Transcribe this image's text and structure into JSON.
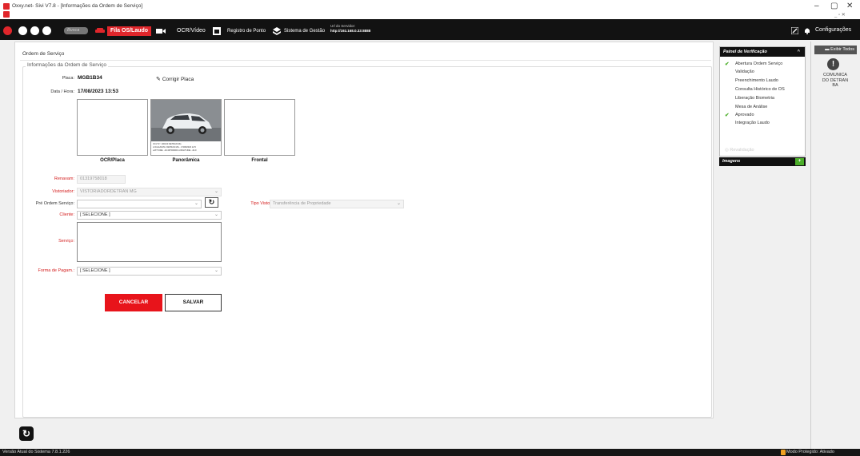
{
  "window": {
    "title": "Oxxy.net- Sivi V7.8 - [Informações da Ordem de Serviço]",
    "controls": [
      "–",
      "▢",
      "✕"
    ],
    "inner_controls": "_ ▫ ✕"
  },
  "toolbar": {
    "search_placeholder": "Busca",
    "tabs": [
      "Fila OS/Laudo",
      "OCR/Vídeo",
      "Registro de Ponto",
      "Sistema de Gestão"
    ],
    "server_label": "Url do Servidor:",
    "server_url": "http://192.168.0.33:8888",
    "settings_label": "Configurações"
  },
  "form": {
    "section_title": "Ordem de Serviço",
    "group_title": "Informações da Ordem de Serviço",
    "placa_label": "Placa:",
    "placa_value": "MGB1B34",
    "corrigir_label": "Corrigir Placa",
    "data_hora_label": "Data / Hora:",
    "data_hora_value": "17/08/2023  13:53",
    "photo_captions": [
      "OCR/Placa",
      "Panorâmica",
      "Frontal"
    ],
    "photo_overlay": [
      "OCV Nº: 100133 DETRAN MG",
      "LOCAL/DATA: DETRAN MG - 17/08/2023 12:5",
      "LATITUDE: -19.467000000 LONGITUDE: -44.9"
    ],
    "renavam_label": "Renavam:",
    "renavam_value": "01319758018",
    "vistoriador_label": "Vistoriador:",
    "vistoriador_value": "VISTORIADORDETRAN MG",
    "pre_ordem_label": "Pré Ordem Serviço:",
    "pre_ordem_value": "",
    "tipo_vistoria_label": "Tipo Vistoria:",
    "tipo_vistoria_value": "Transferência de Propriedade",
    "cliente_label": "Cliente:",
    "cliente_value": "[ SELECIONE ]",
    "servico_label": "Serviço:",
    "forma_pagamento_label": "Forma de Pagam.:",
    "forma_pagamento_value": "[ SELECIONE ]",
    "cancel_label": "CANCELAR",
    "save_label": "SALVAR"
  },
  "panel": {
    "title": "Painel de Verificação",
    "items": [
      {
        "label": "Abertura Ordem Serviço",
        "checked": true
      },
      {
        "label": "Validação",
        "checked": false
      },
      {
        "label": "Preenchimento Laudo",
        "checked": false
      },
      {
        "label": "Consulta Histórico de OS",
        "checked": false
      },
      {
        "label": "Liberação Biometria",
        "checked": false
      },
      {
        "label": "Mesa de Análise",
        "checked": false
      },
      {
        "label": "Aprovado",
        "checked": true
      },
      {
        "label": "Integração Laudo",
        "checked": false
      }
    ],
    "revalidate_label": "Revalidação",
    "images_title": "Imagens"
  },
  "side": {
    "exibir_label": "Exibir Todos",
    "comunica_lines": [
      "COMUNICA",
      "DO DETRAN",
      "BA"
    ]
  },
  "status": {
    "version": "Versão Atual do Sistema 7.8.1.226",
    "protected_mode": "Modo Protegido: Ativado"
  },
  "colors": {
    "accent_red": "#e0262b",
    "check_green": "#4caf2b",
    "toolbar_dark": "#121212"
  }
}
